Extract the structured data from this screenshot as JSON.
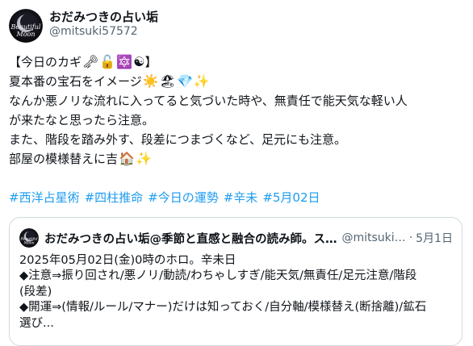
{
  "author": {
    "display_name": "おだみつきの占い垢",
    "handle": "@mitsuki57572",
    "avatar_text_1": "Beautiful",
    "avatar_text_2": "Moon"
  },
  "tweet": {
    "lines": [
      "【今日のカギ",
      "夏本番の宝石をイメージ",
      "なんか悪ノリな流れに入ってると気づいた時や、無責任で能天気な軽い人",
      "が来たなと思ったら注意。",
      "また、階段を踏み外す、段差につまづくなど、足元にも注意。",
      "部屋の模様替えに吉"
    ],
    "line1_emojis": [
      "🗝",
      "🔓",
      "🔯",
      "☯"
    ],
    "line1_close": "】",
    "line2_emojis": [
      "☀️",
      "🏖",
      "💎",
      "✨"
    ],
    "line6_emojis": [
      "🏠",
      "✨"
    ],
    "hashtags": [
      "#西洋占星術",
      "#四柱推命",
      "#今日の運勢",
      "#辛未",
      "#5月02日"
    ]
  },
  "quote": {
    "display_name": "おだみつきの占い垢@季節と直感と融合の読み師。ス…",
    "handle": "@mitsuki…",
    "separator": "·",
    "date": "5月1日",
    "lines": [
      "2025年05月02日(金)0時のホロ。辛未日",
      "◆注意⇒振り回され/悪ノリ/動読/わちゃしすぎ/能天気/無責任/足元注意/階段",
      "(段差)",
      "◆開運⇒(情報/ルール/マナー)だけは知っておく/自分軸/模様替え(断捨離)/鉱石",
      "選び..."
    ]
  },
  "colors": {
    "text": "#0f1419",
    "secondary": "#536471",
    "link": "#1d9bf0",
    "border": "#cfd9de"
  }
}
